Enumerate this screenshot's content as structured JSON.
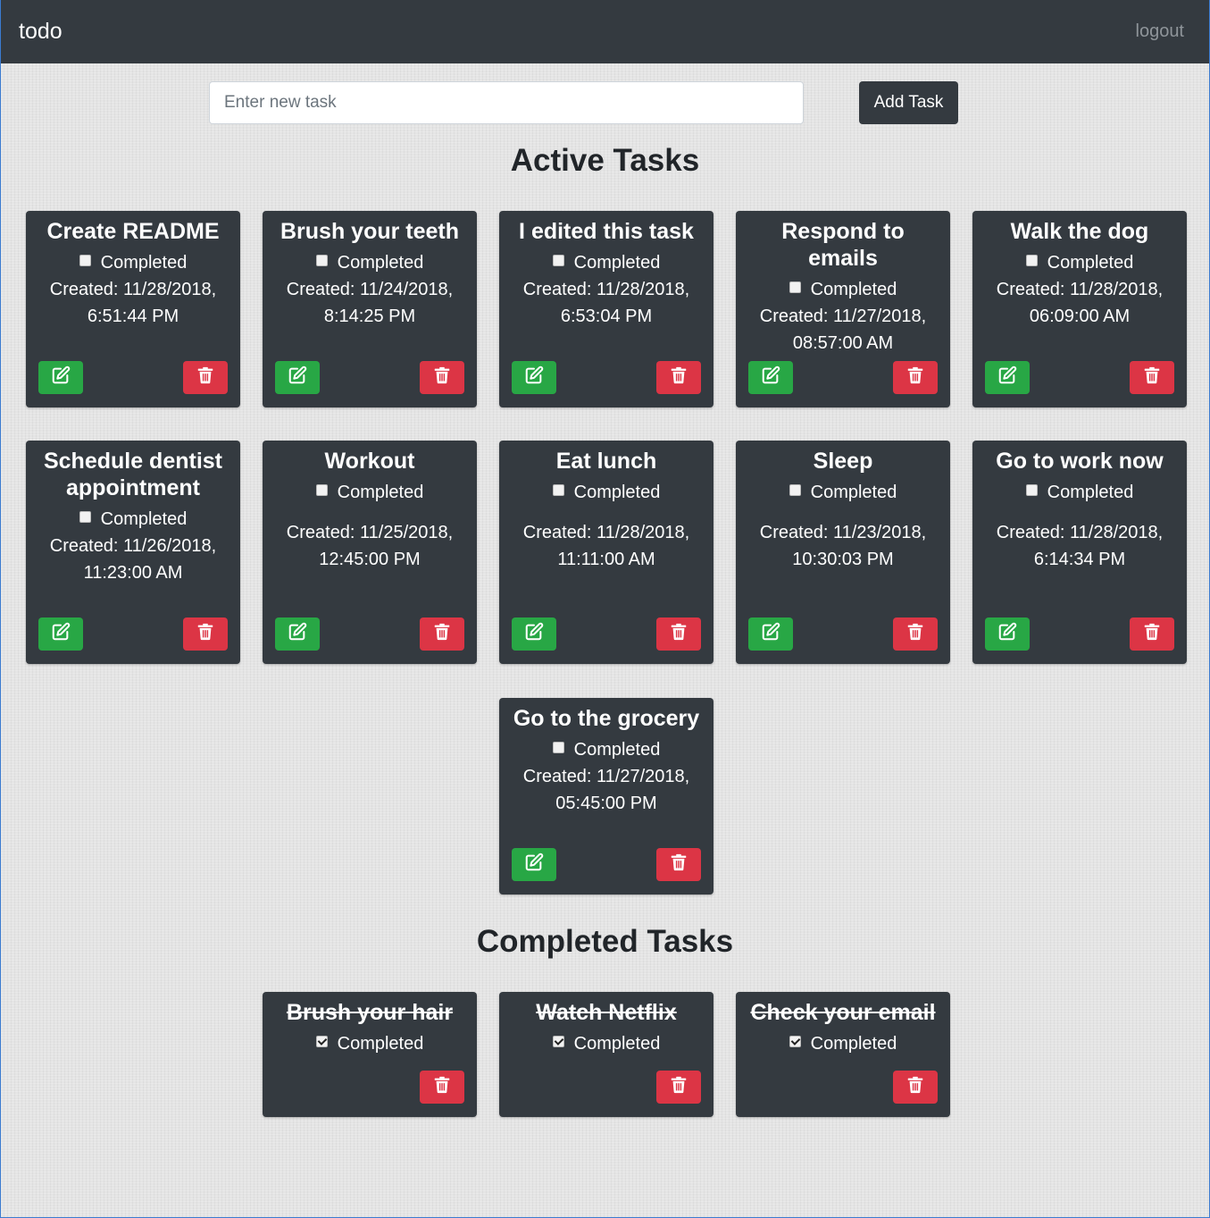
{
  "nav": {
    "brand": "todo",
    "logout": "logout"
  },
  "new_task": {
    "placeholder": "Enter new task",
    "button": "Add Task"
  },
  "active_title": "Active Tasks",
  "completed_title": "Completed Tasks",
  "completed_label": "Completed",
  "active_tasks": [
    {
      "title": "Create README",
      "created_line1": "Created: 11/28/2018,",
      "created_line2": "6:51:44 PM"
    },
    {
      "title": "Brush your teeth",
      "created_line1": "Created: 11/24/2018,",
      "created_line2": "8:14:25 PM"
    },
    {
      "title": "I edited this task",
      "created_line1": "Created: 11/28/2018,",
      "created_line2": "6:53:04 PM"
    },
    {
      "title": "Respond to emails",
      "created_line1": "Created: 11/27/2018,",
      "created_line2": "08:57:00 AM"
    },
    {
      "title": "Walk the dog",
      "created_line1": "Created: 11/28/2018,",
      "created_line2": "06:09:00 AM"
    },
    {
      "title": "Schedule dentist appointment",
      "created_line1": "Created: 11/26/2018,",
      "created_line2": "11:23:00 AM"
    },
    {
      "title": "Workout",
      "created_line1": "Created: 11/25/2018,",
      "created_line2": "12:45:00 PM"
    },
    {
      "title": "Eat lunch",
      "created_line1": "Created: 11/28/2018,",
      "created_line2": "11:11:00 AM"
    },
    {
      "title": "Sleep",
      "created_line1": "Created: 11/23/2018,",
      "created_line2": "10:30:03 PM"
    },
    {
      "title": "Go to work now",
      "created_line1": "Created: 11/28/2018,",
      "created_line2": "6:14:34 PM"
    },
    {
      "title": "Go to the grocery",
      "created_line1": "Created: 11/27/2018,",
      "created_line2": "05:45:00 PM"
    }
  ],
  "completed_tasks": [
    {
      "title": "Brush your hair"
    },
    {
      "title": "Watch Netflix"
    },
    {
      "title": "Check your email"
    }
  ],
  "colors": {
    "navbar": "#343a40",
    "card": "#343a40",
    "edit_button": "#28a745",
    "delete_button": "#dc3545"
  },
  "icons": {
    "edit": "edit-icon",
    "delete": "trash-icon"
  }
}
